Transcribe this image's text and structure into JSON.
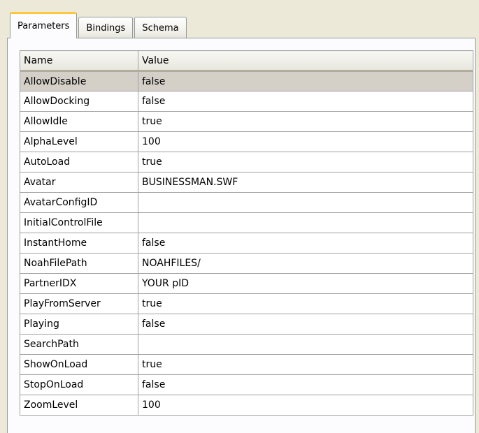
{
  "tabs": [
    {
      "label": "Parameters",
      "active": true
    },
    {
      "label": "Bindings",
      "active": false
    },
    {
      "label": "Schema",
      "active": false
    }
  ],
  "grid": {
    "headers": {
      "name": "Name",
      "value": "Value"
    },
    "rows": [
      {
        "name": "AllowDisable",
        "value": "false"
      },
      {
        "name": "AllowDocking",
        "value": "false"
      },
      {
        "name": "AllowIdle",
        "value": "true"
      },
      {
        "name": "AlphaLevel",
        "value": "100"
      },
      {
        "name": "AutoLoad",
        "value": "true"
      },
      {
        "name": "Avatar",
        "value": "BUSINESSMAN.SWF"
      },
      {
        "name": "AvatarConfigID",
        "value": ""
      },
      {
        "name": "InitialControlFile",
        "value": ""
      },
      {
        "name": "InstantHome",
        "value": "false"
      },
      {
        "name": "NoahFilePath",
        "value": "NOAHFILES/"
      },
      {
        "name": "PartnerIDX",
        "value": "YOUR pID"
      },
      {
        "name": "PlayFromServer",
        "value": "true"
      },
      {
        "name": "Playing",
        "value": "false"
      },
      {
        "name": "SearchPath",
        "value": ""
      },
      {
        "name": "ShowOnLoad",
        "value": "true"
      },
      {
        "name": "StopOnLoad",
        "value": "false"
      },
      {
        "name": "ZoomLevel",
        "value": "100"
      }
    ]
  },
  "colors": {
    "active_tab_accent": "#ffc83c",
    "selected_row": "#d4d0c8"
  }
}
